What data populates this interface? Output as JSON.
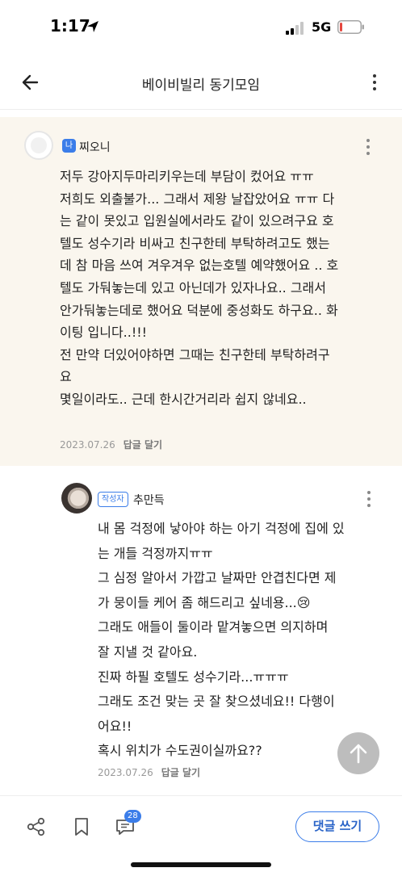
{
  "status": {
    "time": "1:17",
    "network": "5G"
  },
  "header": {
    "title": "베이비빌리 동기모임"
  },
  "comments": [
    {
      "badge": "나",
      "nickname": "찌오니",
      "lines": [
        "저두 강아지두마리키우는데 부담이 컸어요 ㅠㅠ",
        "저희도 외출불가... 그래서 제왕 날잡았어요 ㅠㅠ 다",
        "는 같이 못있고 입원실에서라도 같이 있으려구요 호",
        "텔도 성수기라 비싸고 친구한테 부탁하려고도 했는",
        "데 참 마음 쓰여 겨우겨우 없는호텔 예약했어요 .. 호",
        "텔도 가둬놓는데 있고 아닌데가 있자나요.. 그래서",
        "안가둬놓는데로 했어요 덕분에 중성화도 하구요.. 화",
        "이팅 입니다..!!!",
        "전 만약 더있어야하면 그때는 친구한테 부탁하려구",
        "요",
        "몇일이라도.. 근데 한시간거리라 쉽지 않네요.."
      ],
      "date": "2023.07.26",
      "reply_label": "답글 달기"
    },
    {
      "badge": "작성자",
      "nickname": "추만득",
      "lines": [
        "내 몸 걱정에 낳아야 하는 아기 걱정에 집에 있",
        "는 개들 걱정까지ㅠㅠ",
        "그 심정 알아서 가깝고 날짜만 안겹친다면 제",
        "가 뭉이들 케어 좀 해드리고 싶네용...😢",
        "그래도 애들이 둘이라 맡겨놓으면 의지하며",
        "잘 지낼 것 같아요.",
        "진짜 하필 호텔도 성수기라...ㅠㅠㅠ",
        "그래도 조건 맞는 곳 잘 찾으셨네요!! 다행이",
        "어요!!",
        "혹시 위치가 수도권이실까요??"
      ],
      "date": "2023.07.26",
      "reply_label": "답글 달기"
    }
  ],
  "bottom_bar": {
    "comment_count": "28",
    "write_label": "댓글 쓰기"
  },
  "colors": {
    "accent": "#3b7de9",
    "comment_highlight_bg": "#faf6ee",
    "battery_low": "#e5483f"
  },
  "icons": [
    "location-arrow-icon",
    "signal-icon",
    "battery-icon",
    "back-arrow-icon",
    "more-vertical-icon",
    "share-icon",
    "bookmark-icon",
    "comment-icon",
    "arrow-up-icon"
  ]
}
